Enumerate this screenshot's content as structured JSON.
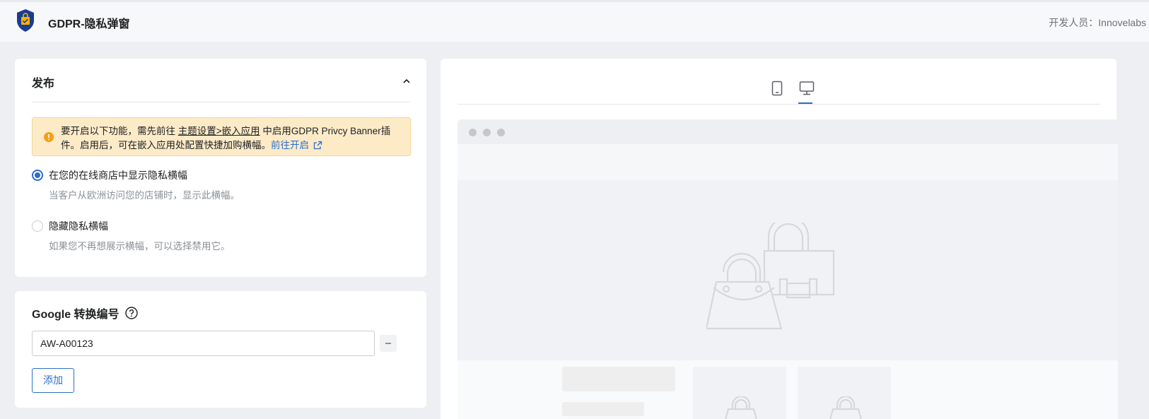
{
  "header": {
    "app_title": "GDPR-隐私弹窗",
    "developer": "开发人员：Innovelabs",
    "logo_icon": "shield-bag-icon",
    "brand_color": "#1d3c8f",
    "badge_color": "#f4b400"
  },
  "publish": {
    "title": "发布",
    "collapse_icon": "chevron-up-icon",
    "notice": {
      "icon": "warning-circle-icon",
      "text_before": "要开启以下功能，需先前往 ",
      "settings_link": "主题设置>嵌入应用",
      "text_after": " 中启用GDPR Privcy Banner插件。启用后，可在嵌入应用处配置快捷加购横幅。",
      "go_link": "前往开启",
      "go_icon": "external-link-icon",
      "bg_color": "#fdebc8"
    },
    "options": [
      {
        "label": "在您的在线商店中显示隐私横幅",
        "help": "当客户从欧洲访问您的店铺时，显示此横幅。",
        "selected": true
      },
      {
        "label": "隐藏隐私横幅",
        "help": "如果您不再想展示横幅，可以选择禁用它。",
        "selected": false
      }
    ]
  },
  "google": {
    "title": "Google 转换编号",
    "help_icon": "question-circle-icon",
    "input_value": "AW-A00123",
    "remove_icon": "minus-icon",
    "add_label": "添加"
  },
  "preview": {
    "tabs": [
      {
        "name": "mobile",
        "icon": "mobile-icon",
        "active": false
      },
      {
        "name": "desktop",
        "icon": "desktop-icon",
        "active": true
      }
    ],
    "accent_color": "#2c6ecb"
  }
}
